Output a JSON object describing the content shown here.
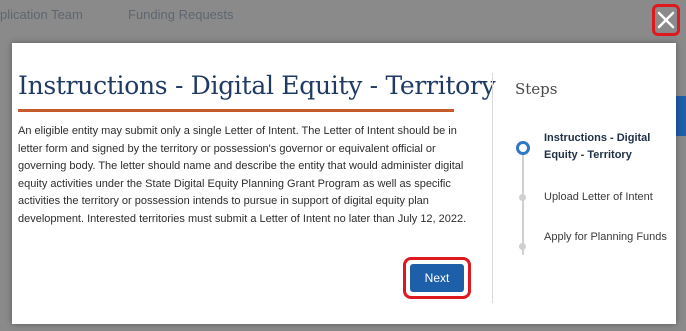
{
  "background": {
    "nav_items": [
      "plication Team",
      "Funding Requests"
    ]
  },
  "modal": {
    "close_icon": "close-icon",
    "title": "Instructions - Digital Equity - Territory",
    "body": "An eligible entity may submit only a single Letter of Intent.  The Letter of Intent should be in letter form and signed by the territory or possession's governor or equivalent official or governing body.  The letter should name and describe the entity that would administer digital equity activities under the State Digital Equity Planning Grant Program as well as specific activities the territory or possession intends to pursue in support of digital equity plan development. Interested territories must submit a Letter of Intent no later than July 12, 2022.",
    "next_label": "Next"
  },
  "steps": {
    "title": "Steps",
    "items": [
      {
        "label": "Instructions - Digital Equity - Territory",
        "active": true
      },
      {
        "label": "Upload Letter of Intent",
        "active": false
      },
      {
        "label": "Apply for Planning Funds",
        "active": false
      }
    ]
  },
  "colors": {
    "accent": "#1d5fa8",
    "title_rule": "#c65b2c",
    "highlight": "#e0191f"
  }
}
